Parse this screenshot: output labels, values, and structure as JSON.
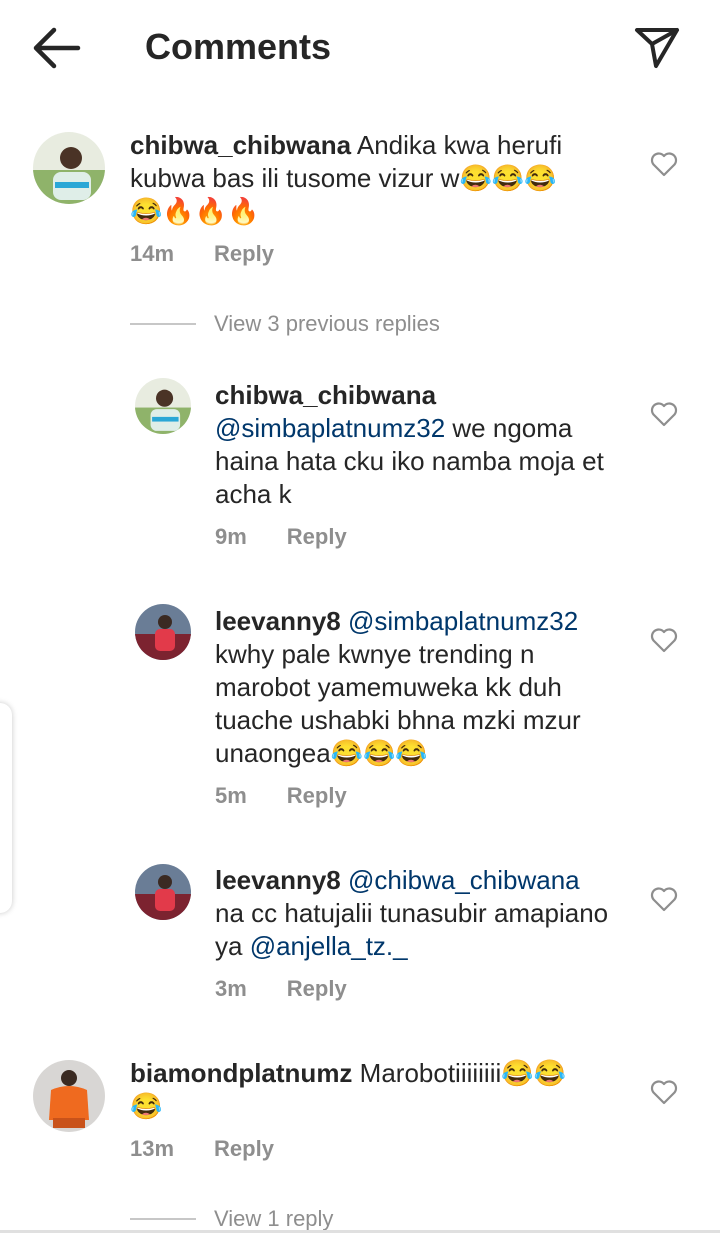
{
  "header": {
    "title": "Comments"
  },
  "comments": [
    {
      "username": "chibwa_chibwana",
      "text": "Andika kwa herufi kubwa bas ili tusome vizur w😂😂😂",
      "text2": "😂🔥🔥🔥",
      "time": "14m",
      "reply_label": "Reply",
      "view_replies": "View 3 previous replies"
    },
    {
      "username": "chibwa_chibwana",
      "mention": "@simbaplatnumz32",
      "text": " we ngoma haina hata cku iko namba moja et acha k",
      "time": "9m",
      "reply_label": "Reply"
    },
    {
      "username": "leevanny8",
      "mention": "@simbaplatnumz32",
      "text": " kwhy pale kwnye trending n marobot yamemuweka kk duh tuache ushabki bhna mzki mzur unaongea😂😂😂",
      "time": "5m",
      "reply_label": "Reply"
    },
    {
      "username": "leevanny8",
      "mention": "@chibwa_chibwana",
      "text": " na cc hatujalii tunasubir amapiano ya ",
      "mention2": "@anjella_tz._",
      "time": "3m",
      "reply_label": "Reply"
    },
    {
      "username": "biamondplatnumz",
      "text": "Marobotiiiiiiii😂😂",
      "text2": "😂",
      "time": "13m",
      "reply_label": "Reply",
      "view_replies": "View 1 reply"
    }
  ],
  "icons": {
    "back": "arrow-left-icon",
    "share": "paper-plane-icon",
    "like": "heart-outline-icon"
  },
  "colors": {
    "mention": "#00376b",
    "secondary_text": "#8e8e8e",
    "primary_text": "#262626"
  }
}
